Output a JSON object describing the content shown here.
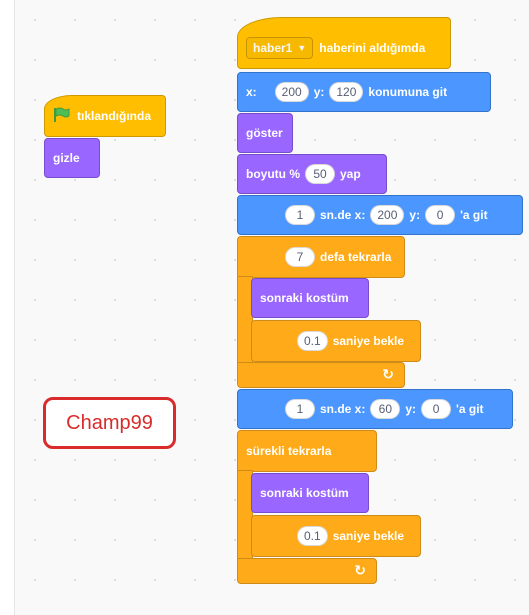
{
  "stack_left": {
    "when_flag_clicked": "tıklandığında",
    "hide": "gizle"
  },
  "stack_main": {
    "receive_dropdown": "haber1",
    "receive_label": "haberini aldığımda",
    "goto_x_label": "x:",
    "goto_x_value": "200",
    "goto_y_label": "y:",
    "goto_y_value": "120",
    "goto_suffix": "konumuna git",
    "show": "göster",
    "size_prefix": "boyutu %",
    "size_value": "50",
    "size_suffix": "yap",
    "glide1_seconds": "1",
    "glide1_mid": "sn.de x:",
    "glide1_x": "200",
    "glide1_y_label": "y:",
    "glide1_y": "0",
    "glide1_suffix": "'a git",
    "repeat_count": "7",
    "repeat_label": "defa tekrarla",
    "next_costume_1": "sonraki kostüm",
    "wait1_value": "0.1",
    "wait1_label": "saniye bekle",
    "glide2_seconds": "1",
    "glide2_mid": "sn.de x:",
    "glide2_x": "60",
    "glide2_y_label": "y:",
    "glide2_y": "0",
    "glide2_suffix": "'a git",
    "forever_label": "sürekli tekrarla",
    "next_costume_2": "sonraki kostüm",
    "wait2_value": "0.1",
    "wait2_label": "saniye bekle"
  },
  "watermark": "Champ99",
  "colors": {
    "motion": "#4c97ff",
    "looks": "#9966ff",
    "events": "#ffbf00",
    "control": "#ffab19",
    "watermark": "#d92b2b"
  }
}
